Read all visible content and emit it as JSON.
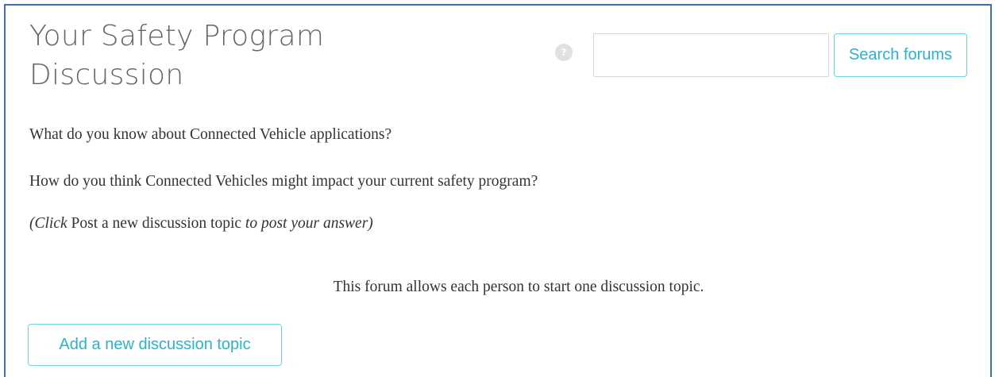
{
  "header": {
    "title": "Your Safety Program Discussion",
    "help_icon": "question-circle-icon",
    "help_glyph": "?"
  },
  "search": {
    "value": "",
    "placeholder": "",
    "button_label": "Search forums"
  },
  "intro": {
    "question_1": "What do you know about Connected Vehicle applications?",
    "question_2": "How do you think Connected Vehicles might impact your current safety program?",
    "hint_prefix": "(Click ",
    "hint_link_text": "Post a new discussion topic",
    "hint_suffix": " to post your answer)"
  },
  "forum": {
    "notice": "This forum allows each person to start one discussion topic.",
    "add_topic_label": "Add a new discussion topic"
  },
  "colors": {
    "accent": "#2cb3cc",
    "button_border": "#6fd3df",
    "frame_border": "#3b6fc4",
    "title_text": "#666666",
    "body_text": "#333333"
  }
}
